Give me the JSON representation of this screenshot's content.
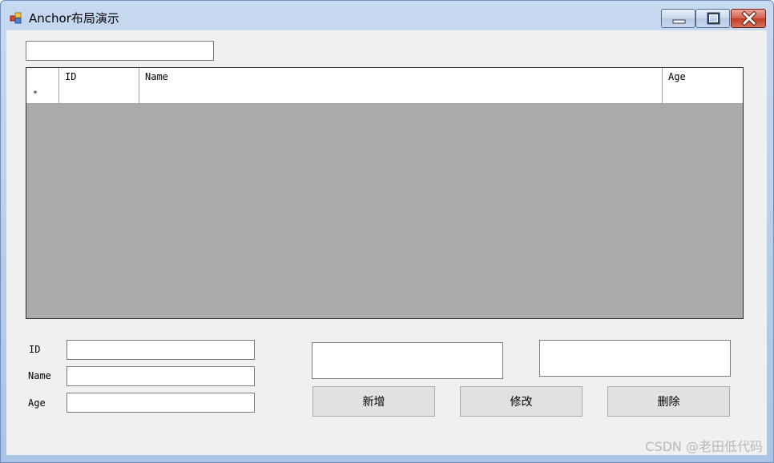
{
  "window": {
    "title": "Anchor布局演示",
    "icon": "winforms-app-icon",
    "controls": [
      "minimize-icon",
      "maximize-icon",
      "close-icon"
    ]
  },
  "search": {
    "value": ""
  },
  "grid": {
    "columns": [
      "",
      "ID",
      "Name",
      "Age"
    ],
    "new_row": {
      "marker": "*",
      "cells": [
        "",
        "",
        ""
      ]
    },
    "empty_area_color": "#ababab"
  },
  "form": {
    "id_label": "ID",
    "name_label": "Name",
    "age_label": "Age",
    "id_value": "",
    "name_value": "",
    "age_value": ""
  },
  "extra_boxes": {
    "box1": "",
    "box2": ""
  },
  "buttons": {
    "add": "新增",
    "edit": "修改",
    "delete": "删除"
  },
  "watermark": "CSDN @老田低代码",
  "colors": {
    "client_bg": "#f0f0f0",
    "button_bg": "#e1e1e1",
    "close_button": "#c43c23"
  }
}
